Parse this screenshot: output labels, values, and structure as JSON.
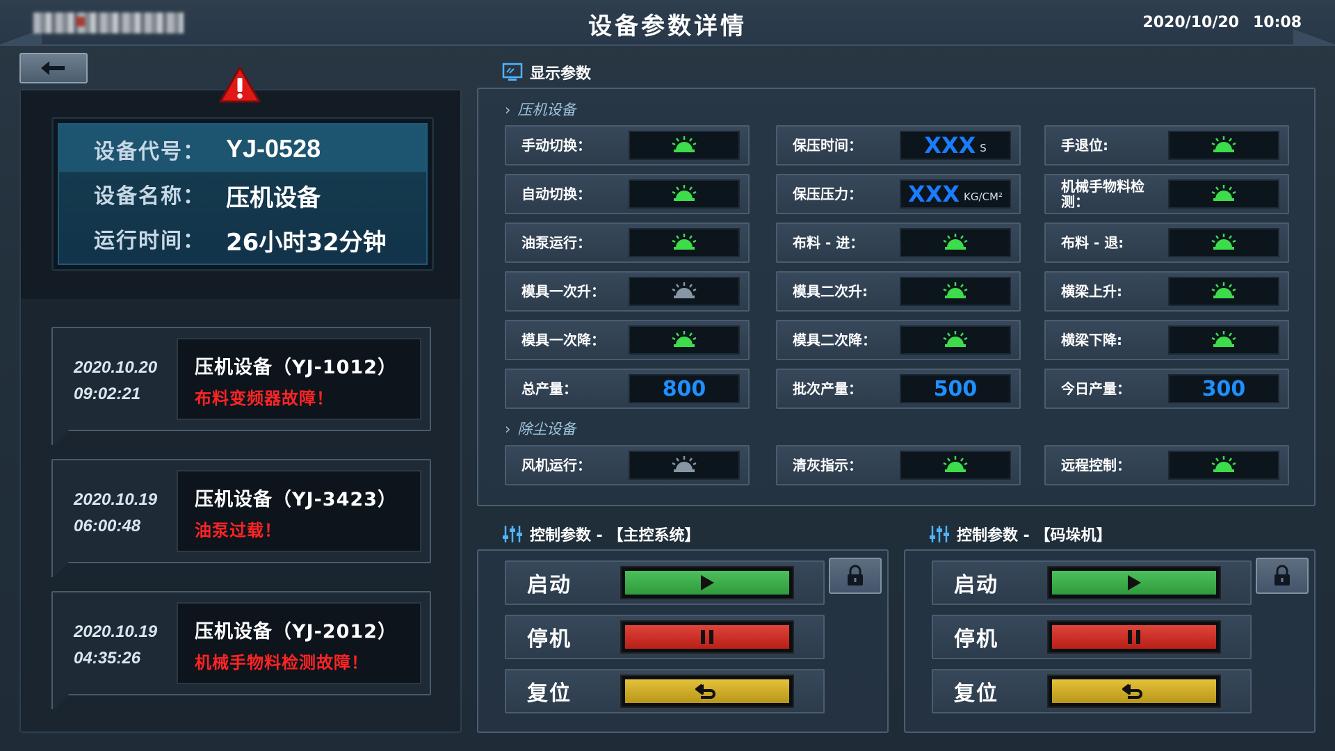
{
  "header": {
    "title": "设备参数详情",
    "date": "2020/10/20",
    "time": "10:08"
  },
  "device": {
    "code_label": "设备代号：",
    "code": "YJ-0528",
    "name_label": "设备名称：",
    "name": "压机设备",
    "runtime_label": "运行时间：",
    "runtime": "26小时32分钟"
  },
  "alarms": [
    {
      "date": "2020.10.20",
      "time": "09:02:21",
      "title": "压机设备（YJ-1012）",
      "fault": "布料变频器故障！"
    },
    {
      "date": "2020.10.19",
      "time": "06:00:48",
      "title": "压机设备（YJ-3423）",
      "fault": "油泵过载！"
    },
    {
      "date": "2020.10.19",
      "time": "04:35:26",
      "title": "压机设备（YJ-2012）",
      "fault": "机械手物料检测故障！"
    }
  ],
  "display": {
    "title": "显示参数",
    "press": {
      "title": "压机设备",
      "rows": [
        [
          {
            "label": "手动切换：",
            "type": "lamp",
            "on": true
          },
          {
            "label": "保压时间：",
            "type": "xxx",
            "value": "XXX",
            "unit": "S"
          },
          {
            "label": "手退位:",
            "type": "lamp",
            "on": true
          }
        ],
        [
          {
            "label": "自动切换：",
            "type": "lamp",
            "on": true
          },
          {
            "label": "保压压力：",
            "type": "xxx",
            "value": "XXX",
            "unit": "KG/CM²"
          },
          {
            "label": "机械手物料检测：",
            "type": "lamp",
            "on": true
          }
        ],
        [
          {
            "label": "油泵运行：",
            "type": "lamp",
            "on": true
          },
          {
            "label": "布料 - 进：",
            "type": "lamp",
            "on": true
          },
          {
            "label": "布料 - 退:",
            "type": "lamp",
            "on": true
          }
        ],
        [
          {
            "label": "模具一次升：",
            "type": "lamp",
            "on": false
          },
          {
            "label": "模具二次升:",
            "type": "lamp",
            "on": true
          },
          {
            "label": "横梁上升:",
            "type": "lamp",
            "on": true
          }
        ],
        [
          {
            "label": "模具一次降：",
            "type": "lamp",
            "on": true
          },
          {
            "label": "模具二次降：",
            "type": "lamp",
            "on": true
          },
          {
            "label": "横梁下降:",
            "type": "lamp",
            "on": true
          }
        ],
        [
          {
            "label": "总产量：",
            "type": "num",
            "value": "800"
          },
          {
            "label": "批次产量：",
            "type": "num",
            "value": "500"
          },
          {
            "label": "今日产量：",
            "type": "num",
            "value": "300"
          }
        ]
      ]
    },
    "dust": {
      "title": "除尘设备",
      "rows": [
        [
          {
            "label": "风机运行：",
            "type": "lamp",
            "on": false
          },
          {
            "label": "清灰指示：",
            "type": "lamp",
            "on": true
          },
          {
            "label": "远程控制：",
            "type": "lamp",
            "on": true
          }
        ]
      ]
    }
  },
  "controls": [
    {
      "title": "控制参数 - 【主控系统】",
      "start": "启动",
      "stop": "停机",
      "reset": "复位"
    },
    {
      "title": "控制参数 - 【码垛机】",
      "start": "启动",
      "stop": "停机",
      "reset": "复位"
    }
  ],
  "colors": {
    "lamp_on": "#3ddc4a",
    "lamp_off": "#8796a5",
    "value_blue": "#1e90ff",
    "fault_red": "#ff2424"
  }
}
